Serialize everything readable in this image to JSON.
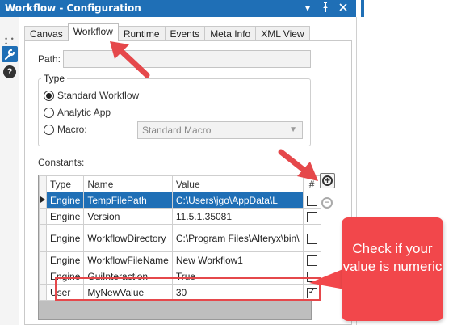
{
  "window": {
    "title": "Workflow - Configuration",
    "controls": [
      "▾",
      "✦",
      "✕"
    ]
  },
  "tabs": [
    {
      "label": "Canvas",
      "active": false
    },
    {
      "label": "Workflow",
      "active": true
    },
    {
      "label": "Runtime",
      "active": false
    },
    {
      "label": "Events",
      "active": false
    },
    {
      "label": "Meta Info",
      "active": false
    },
    {
      "label": "XML View",
      "active": false
    }
  ],
  "path": {
    "label": "Path:",
    "value": ""
  },
  "type_group": {
    "title": "Type",
    "options": [
      {
        "label": "Standard Workflow",
        "selected": true
      },
      {
        "label": "Analytic App",
        "selected": false
      },
      {
        "label": "Macro:",
        "selected": false
      }
    ],
    "macro_select": "Standard Macro"
  },
  "constants": {
    "label": "Constants:",
    "columns": [
      "Type",
      "Name",
      "Value",
      "#"
    ],
    "rows": [
      {
        "type": "Engine",
        "name": "TempFilePath",
        "value": "C:\\Users\\jgo\\AppData\\L",
        "numeric": false,
        "selected": true
      },
      {
        "type": "Engine",
        "name": "Version",
        "value": "11.5.1.35081",
        "numeric": false,
        "selected": false
      },
      {
        "type": "Engine",
        "name": "WorkflowDirectory",
        "value": "C:\\Program Files\\Alteryx\\bin\\",
        "numeric": false,
        "selected": false
      },
      {
        "type": "Engine",
        "name": "WorkflowFileName",
        "value": "New Workflow1",
        "numeric": false,
        "selected": false
      },
      {
        "type": "Engine",
        "name": "GuiInteraction",
        "value": "True",
        "numeric": false,
        "selected": false
      },
      {
        "type": "User",
        "name": "MyNewValue",
        "value": "30",
        "numeric": true,
        "selected": false
      }
    ]
  },
  "buttons": {
    "add": "+",
    "remove": "−"
  },
  "annotation": {
    "callout_text": "Check if your value is numeric",
    "accent_color": "#f2474b",
    "title_bar_color": "#1f6fb6"
  },
  "icons": {
    "tool": "wrench-icon",
    "help": "help-icon",
    "row_pointer": "triangle-right-icon"
  }
}
